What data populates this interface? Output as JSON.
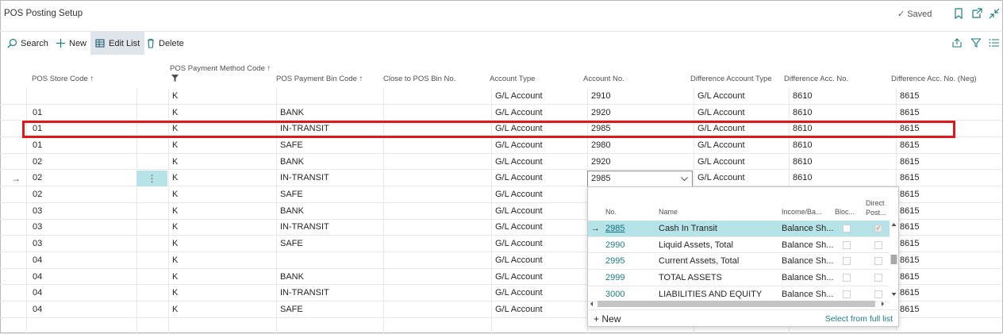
{
  "window": {
    "title": "POS Posting Setup",
    "saved_label": "Saved"
  },
  "actions": {
    "search": "Search",
    "new": "New",
    "edit_list": "Edit List",
    "delete": "Delete"
  },
  "columns": {
    "store": "POS Store Code",
    "store_sort": "↑",
    "method": "POS Payment Method Code",
    "method_sort": "↑",
    "bin": "POS Payment Bin Code",
    "bin_sort": "↑",
    "close_bin": "Close to POS Bin No.",
    "acc_type": "Account Type",
    "acc_no": "Account No.",
    "diff_type": "Difference Account Type",
    "diff_no": "Difference Acc. No.",
    "diff_neg": "Difference Acc. No. (Neg)"
  },
  "rows": [
    {
      "store": "",
      "method": "K",
      "bin": "",
      "close": "",
      "acc_type": "G/L Account",
      "acc_no": "2910",
      "diff_type": "G/L Account",
      "diff_no": "8610",
      "diff_neg": "8615"
    },
    {
      "store": "01",
      "method": "K",
      "bin": "BANK",
      "close": "",
      "acc_type": "G/L Account",
      "acc_no": "2920",
      "diff_type": "G/L Account",
      "diff_no": "8610",
      "diff_neg": "8615"
    },
    {
      "store": "01",
      "method": "K",
      "bin": "IN-TRANSIT",
      "close": "",
      "acc_type": "G/L Account",
      "acc_no": "2985",
      "diff_type": "G/L Account",
      "diff_no": "8610",
      "diff_neg": "8615"
    },
    {
      "store": "01",
      "method": "K",
      "bin": "SAFE",
      "close": "",
      "acc_type": "G/L Account",
      "acc_no": "2980",
      "diff_type": "G/L Account",
      "diff_no": "8610",
      "diff_neg": "8615"
    },
    {
      "store": "02",
      "method": "K",
      "bin": "BANK",
      "close": "",
      "acc_type": "G/L Account",
      "acc_no": "2920",
      "diff_type": "G/L Account",
      "diff_no": "8610",
      "diff_neg": "8615"
    },
    {
      "store": "02",
      "method": "K",
      "bin": "IN-TRANSIT",
      "close": "",
      "acc_type": "G/L Account",
      "acc_no": "2985",
      "diff_type": "G/L Account",
      "diff_no": "8610",
      "diff_neg": "8615"
    },
    {
      "store": "02",
      "method": "K",
      "bin": "SAFE",
      "close": "",
      "acc_type": "G/L Account",
      "acc_no": "",
      "diff_type": "",
      "diff_no": "",
      "diff_neg": "8615"
    },
    {
      "store": "03",
      "method": "K",
      "bin": "BANK",
      "close": "",
      "acc_type": "G/L Account",
      "acc_no": "",
      "diff_type": "",
      "diff_no": "",
      "diff_neg": "8615"
    },
    {
      "store": "03",
      "method": "K",
      "bin": "IN-TRANSIT",
      "close": "",
      "acc_type": "G/L Account",
      "acc_no": "",
      "diff_type": "",
      "diff_no": "",
      "diff_neg": "8615"
    },
    {
      "store": "03",
      "method": "K",
      "bin": "SAFE",
      "close": "",
      "acc_type": "G/L Account",
      "acc_no": "",
      "diff_type": "",
      "diff_no": "",
      "diff_neg": "8615"
    },
    {
      "store": "04",
      "method": "K",
      "bin": "",
      "close": "",
      "acc_type": "G/L Account",
      "acc_no": "",
      "diff_type": "",
      "diff_no": "",
      "diff_neg": "8615"
    },
    {
      "store": "04",
      "method": "K",
      "bin": "BANK",
      "close": "",
      "acc_type": "G/L Account",
      "acc_no": "",
      "diff_type": "",
      "diff_no": "",
      "diff_neg": "8615"
    },
    {
      "store": "04",
      "method": "K",
      "bin": "IN-TRANSIT",
      "close": "",
      "acc_type": "G/L Account",
      "acc_no": "",
      "diff_type": "",
      "diff_no": "",
      "diff_neg": "8615"
    },
    {
      "store": "04",
      "method": "K",
      "bin": "SAFE",
      "close": "",
      "acc_type": "G/L Account",
      "acc_no": "",
      "diff_type": "",
      "diff_no": "",
      "diff_neg": "8615"
    },
    {
      "store": "",
      "method": "",
      "bin": "",
      "close": "",
      "acc_type": "",
      "acc_no": "",
      "diff_type": "",
      "diff_no": "",
      "diff_neg": ""
    }
  ],
  "lookup": {
    "headers": {
      "no": "No.",
      "name": "Name",
      "income": "Income/Ba...",
      "blocked": "Bloc...",
      "direct_line1": "Direct",
      "direct_line2": "Post..."
    },
    "rows": [
      {
        "no": "2985",
        "name": "Cash In Transit",
        "income": "Balance Sh...",
        "blocked": false,
        "direct": true
      },
      {
        "no": "2990",
        "name": "Liquid Assets, Total",
        "income": "Balance Sh...",
        "blocked": false,
        "direct": false
      },
      {
        "no": "2995",
        "name": "Current Assets, Total",
        "income": "Balance Sh...",
        "blocked": false,
        "direct": false
      },
      {
        "no": "2999",
        "name": "TOTAL ASSETS",
        "income": "Balance Sh...",
        "blocked": false,
        "direct": false
      },
      {
        "no": "3000",
        "name": "LIABILITIES AND EQUITY",
        "income": "Balance Sh...",
        "blocked": false,
        "direct": false
      }
    ],
    "new_label": "New",
    "full_list_label": "Select from full list"
  },
  "colors": {
    "accent": "#1f7c84",
    "selection": "#b6e3e8",
    "highlight_border": "#e0181b"
  },
  "icons": [
    "search-icon",
    "plus-icon",
    "edit-list-icon",
    "delete-icon",
    "share-icon",
    "filter-icon",
    "list-icon",
    "bookmark-icon",
    "open-new-window-icon",
    "collapse-icon",
    "chevron-down-icon",
    "row-arrow-icon",
    "more-options-icon"
  ]
}
